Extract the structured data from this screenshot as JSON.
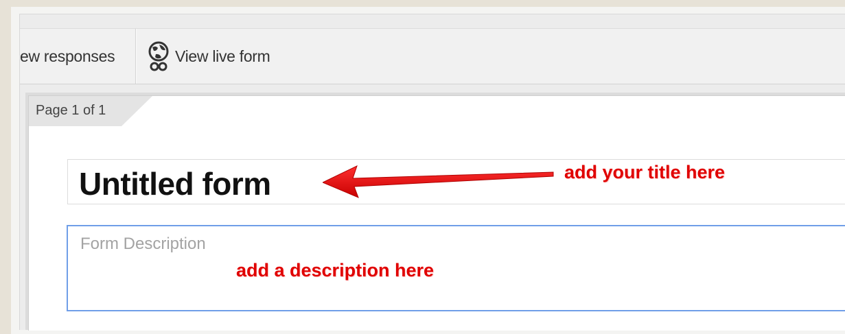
{
  "toolbar": {
    "responses_label": "ew responses",
    "view_live_form_label": "View live form",
    "view_live_form_icon": "globe-icon"
  },
  "page": {
    "tab_label": "Page 1 of 1"
  },
  "form": {
    "title": "Untitled form",
    "description_placeholder": "Form Description"
  },
  "annotations": {
    "title_hint": "add your title here",
    "description_hint": "add a description here",
    "color": "#e00000"
  }
}
